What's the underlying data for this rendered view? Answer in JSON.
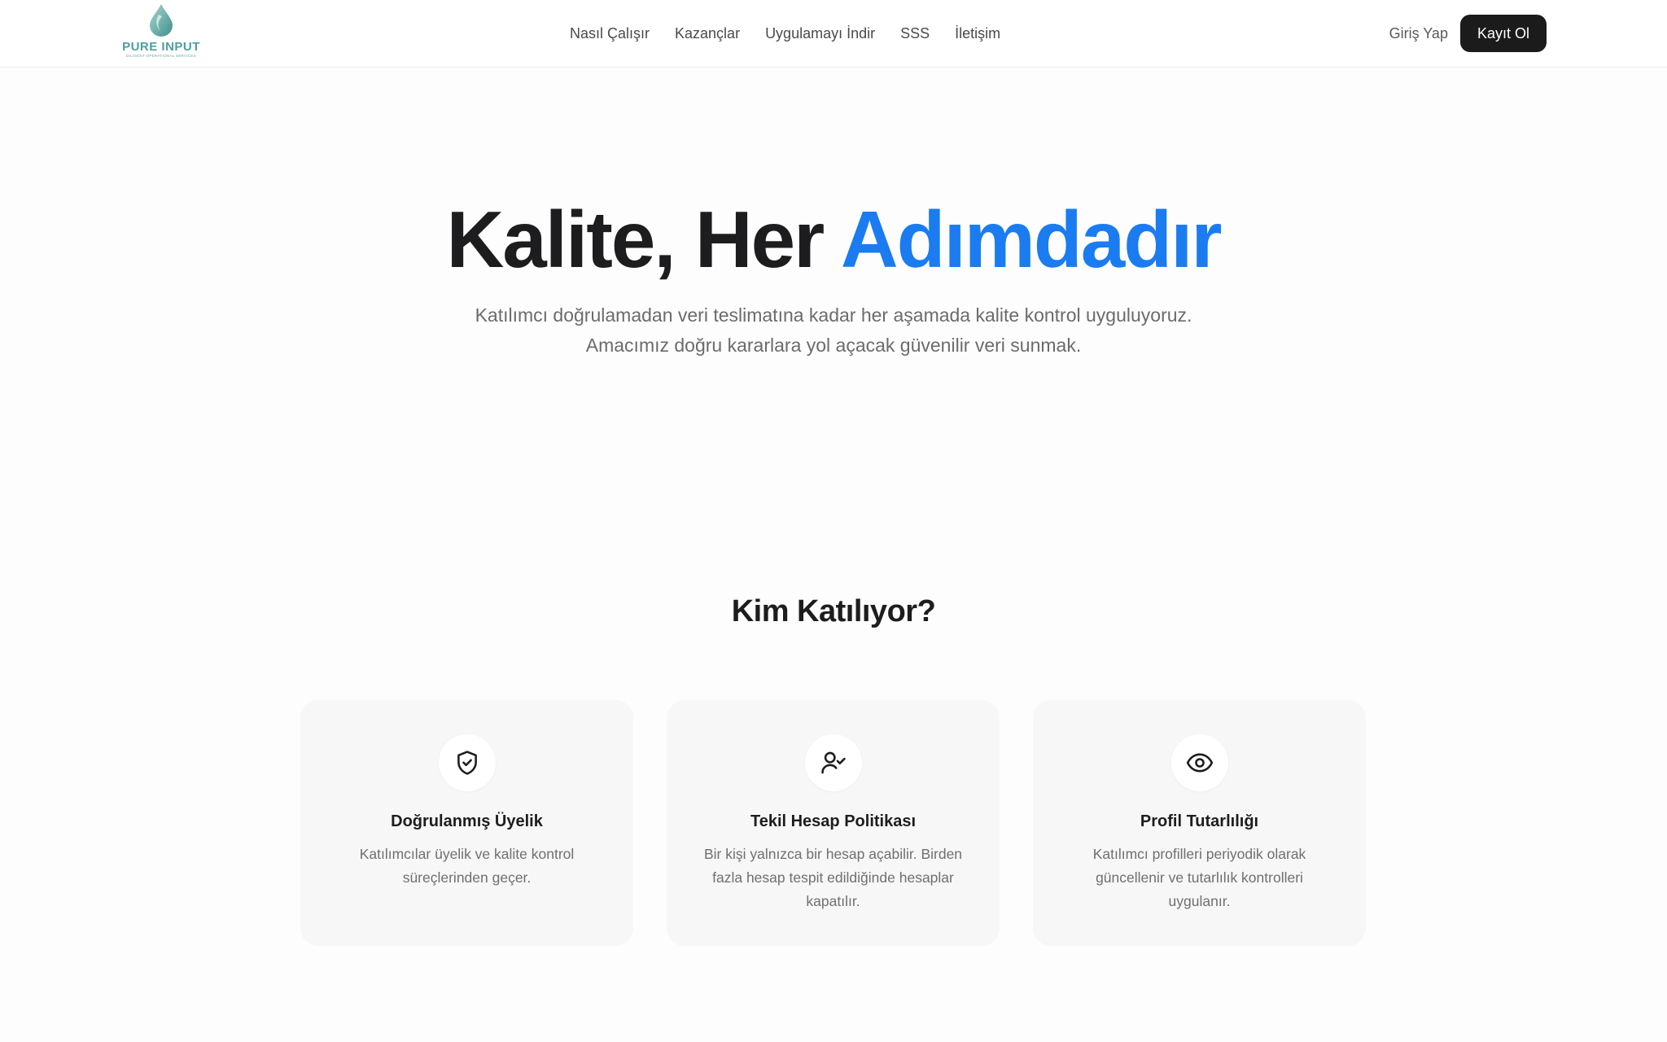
{
  "brand": {
    "name": "PURE INPUT",
    "tagline": "DILIGENT OPERATIONAL SERVICES",
    "accent_color": "#4d9e9c"
  },
  "nav": {
    "links": [
      "Nasıl Çalışır",
      "Kazançlar",
      "Uygulamayı İndir",
      "SSS",
      "İletişim"
    ],
    "login_label": "Giriş Yap",
    "signup_label": "Kayıt Ol"
  },
  "hero": {
    "title_part1": "Kalite, Her ",
    "title_accent": "Adımdadır",
    "accent_color": "#1a7cf0",
    "subtitle": "Katılımcı doğrulamadan veri teslimatına kadar her aşamada kalite kontrol uyguluyoruz. Amacımız doğru kararlara yol açacak güvenilir veri sunmak."
  },
  "section": {
    "title": "Kim Katılıyor?",
    "cards": [
      {
        "icon": "shield-check-icon",
        "title": "Doğrulanmış Üyelik",
        "description": "Katılımcılar üyelik ve kalite kontrol süreçlerinden geçer."
      },
      {
        "icon": "user-check-icon",
        "title": "Tekil Hesap Politikası",
        "description": "Bir kişi yalnızca bir hesap açabilir. Birden fazla hesap tespit edildiğinde hesaplar kapatılır."
      },
      {
        "icon": "eye-icon",
        "title": "Profil Tutarlılığı",
        "description": "Katılımcı profilleri periyodik olarak güncellenir ve tutarlılık kontrolleri uygulanır."
      }
    ]
  }
}
